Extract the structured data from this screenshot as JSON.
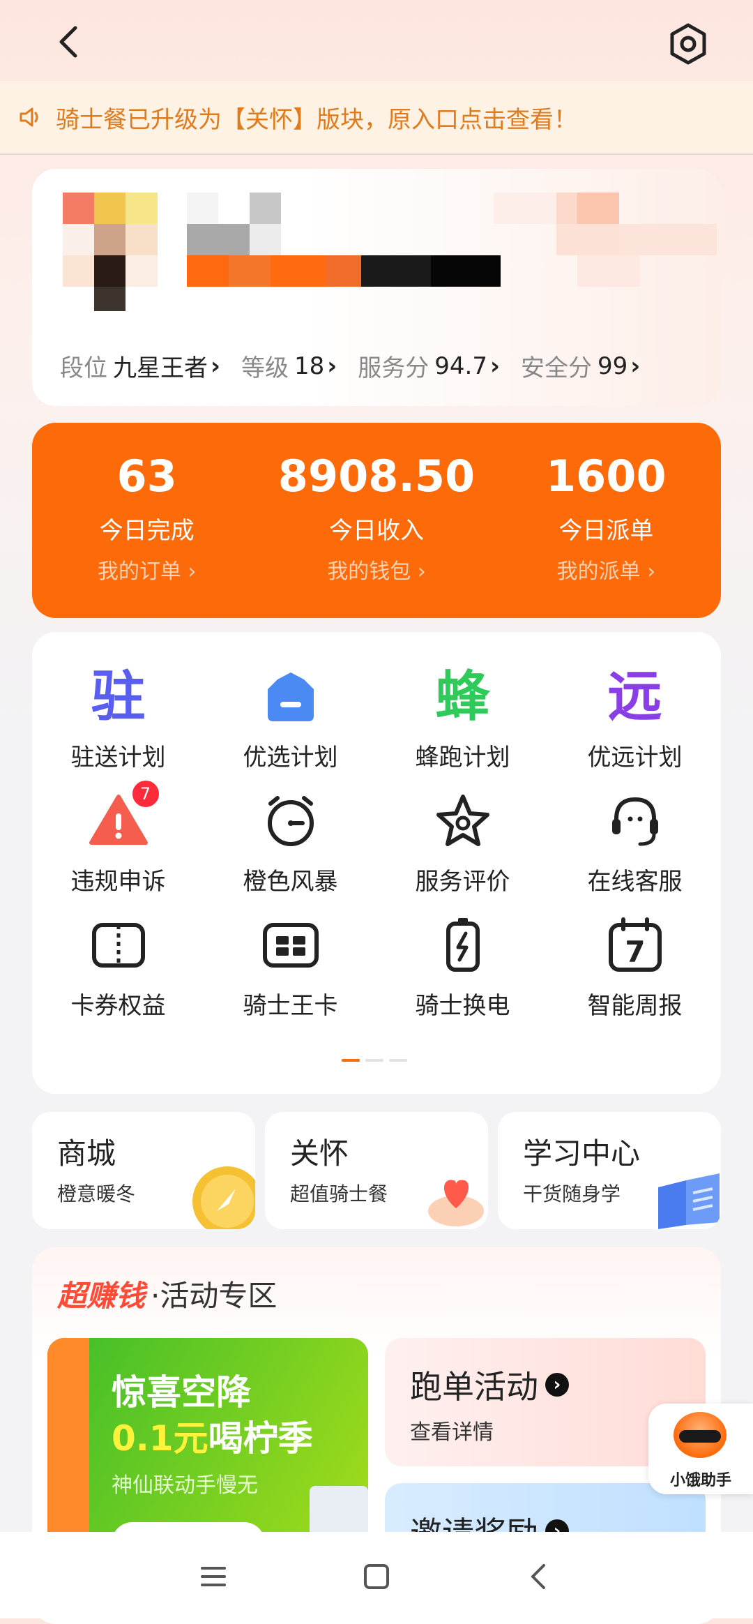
{
  "notice": {
    "text": "骑士餐已升级为【关怀】版块，原入口点击查看！"
  },
  "profile": {
    "stats": [
      {
        "label": "段位",
        "value": "九星王者"
      },
      {
        "label": "等级",
        "value": "18"
      },
      {
        "label": "服务分",
        "value": "94.7"
      },
      {
        "label": "安全分",
        "value": "99"
      }
    ]
  },
  "summary": [
    {
      "value": "63",
      "label": "今日完成",
      "link": "我的订单 ›"
    },
    {
      "value": "8908.50",
      "label": "今日收入",
      "link": "我的钱包 ›"
    },
    {
      "value": "1600",
      "label": "今日派单",
      "link": "我的派单 ›"
    }
  ],
  "grid": [
    {
      "label": "驻送计划",
      "icon": "zhu-char-icon",
      "char": "驻",
      "color": "#5a5ef0"
    },
    {
      "label": "优选计划",
      "icon": "crown-icon"
    },
    {
      "label": "蜂跑计划",
      "icon": "feng-char-icon",
      "char": "蜂",
      "color": "#2ecb5a"
    },
    {
      "label": "优远计划",
      "icon": "yuan-char-icon",
      "char": "远",
      "color": "#8a3ee6"
    },
    {
      "label": "违规申诉",
      "icon": "warning-icon",
      "badge": "7"
    },
    {
      "label": "橙色风暴",
      "icon": "alarm-clock-icon"
    },
    {
      "label": "服务评价",
      "icon": "star-icon"
    },
    {
      "label": "在线客服",
      "icon": "headset-icon"
    },
    {
      "label": "卡券权益",
      "icon": "ticket-icon"
    },
    {
      "label": "骑士王卡",
      "icon": "card-icon"
    },
    {
      "label": "骑士换电",
      "icon": "battery-icon"
    },
    {
      "label": "智能周报",
      "icon": "calendar-7-icon",
      "char": "7"
    }
  ],
  "shortcuts": [
    {
      "title": "商城",
      "sub": "橙意暖冬"
    },
    {
      "title": "关怀",
      "sub": "超值骑士餐"
    },
    {
      "title": "学习中心",
      "sub": "干货随身学"
    }
  ],
  "activity": {
    "brand": "超赚钱",
    "title": "·活动专区",
    "promo": {
      "line1": "惊喜空降",
      "line2_hl": "0.1元",
      "line2": "喝柠季",
      "line3": "神仙联动手慢无"
    },
    "run": {
      "title": "跑单活动",
      "sub": "查看详情"
    },
    "invite": {
      "title": "邀请奖励"
    }
  },
  "assistant": {
    "label": "小饿助手"
  },
  "colors": {
    "accent": "#fd6a0a",
    "notice_text": "#e07a1b",
    "badge": "#ff2a3a"
  }
}
